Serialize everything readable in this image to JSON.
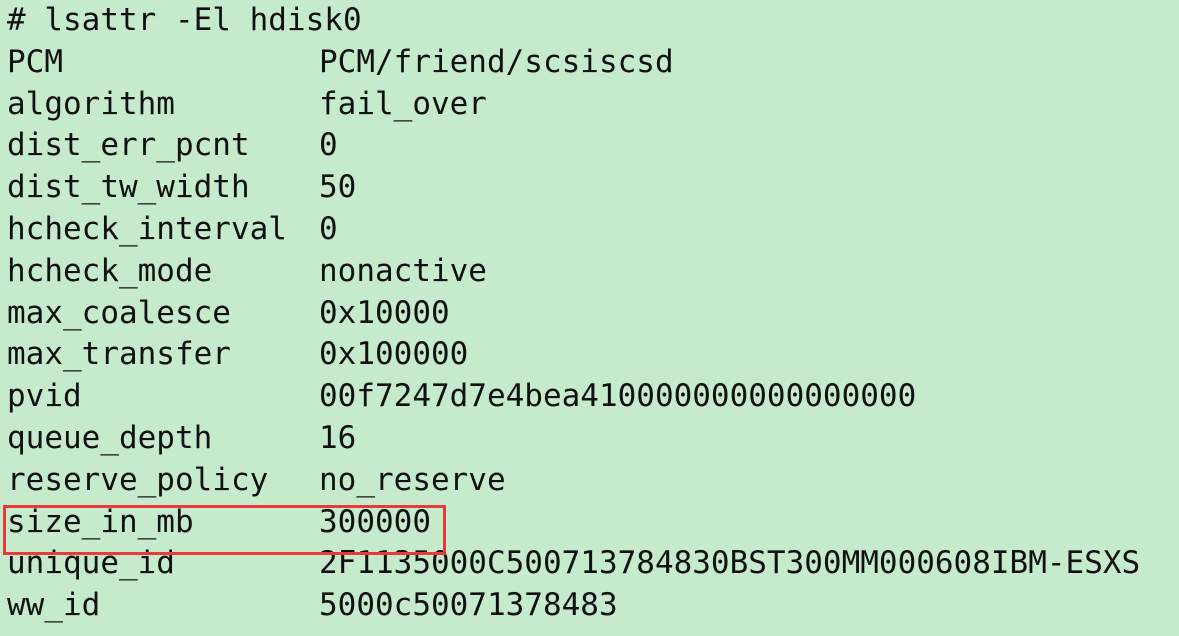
{
  "command": "# lsattr -El hdisk0",
  "attributes": [
    {
      "name": "PCM",
      "value": "PCM/friend/scsiscsd"
    },
    {
      "name": "algorithm",
      "value": "fail_over"
    },
    {
      "name": "dist_err_pcnt",
      "value": "0"
    },
    {
      "name": "dist_tw_width",
      "value": "50"
    },
    {
      "name": "hcheck_interval",
      "value": "0"
    },
    {
      "name": "hcheck_mode",
      "value": "nonactive"
    },
    {
      "name": "max_coalesce",
      "value": "0x10000"
    },
    {
      "name": "max_transfer",
      "value": "0x100000"
    },
    {
      "name": "pvid",
      "value": "00f7247d7e4bea410000000000000000"
    },
    {
      "name": "queue_depth",
      "value": "16"
    },
    {
      "name": "reserve_policy",
      "value": "no_reserve"
    },
    {
      "name": "size_in_mb",
      "value": "300000"
    },
    {
      "name": "unique_id",
      "value": "2F1135000C500713784830BST300MM000608IBM-ESXS"
    },
    {
      "name": "ww_id",
      "value": "5000c50071378483"
    }
  ],
  "colors": {
    "background": "#c6ebcc",
    "text": "#111111",
    "highlight_border": "#e8393b"
  }
}
